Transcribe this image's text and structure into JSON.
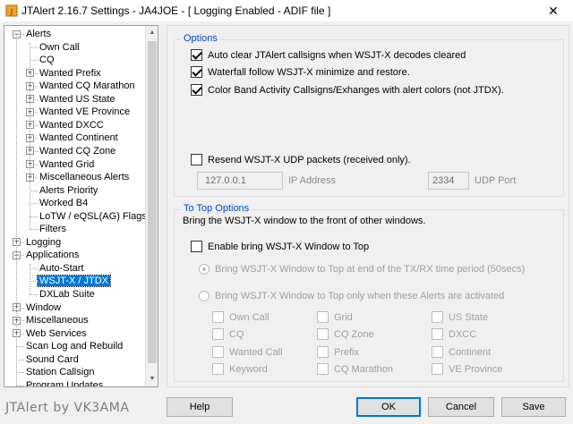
{
  "window": {
    "title": "JTAlert 2.16.7 Settings  -  JA4JOE  -  [ Logging Enabled - ADIF file ]",
    "close_glyph": "✕"
  },
  "tree": {
    "items": [
      {
        "label": "Alerts",
        "level": 0,
        "expander": "−"
      },
      {
        "label": "Own Call",
        "level": 1
      },
      {
        "label": "CQ",
        "level": 1
      },
      {
        "label": "Wanted Prefix",
        "level": 1,
        "expander": "+"
      },
      {
        "label": "Wanted CQ Marathon",
        "level": 1,
        "expander": "+"
      },
      {
        "label": "Wanted US State",
        "level": 1,
        "expander": "+"
      },
      {
        "label": "Wanted VE Province",
        "level": 1,
        "expander": "+"
      },
      {
        "label": "Wanted DXCC",
        "level": 1,
        "expander": "+"
      },
      {
        "label": "Wanted Continent",
        "level": 1,
        "expander": "+"
      },
      {
        "label": "Wanted CQ Zone",
        "level": 1,
        "expander": "+"
      },
      {
        "label": "Wanted Grid",
        "level": 1,
        "expander": "+"
      },
      {
        "label": "Miscellaneous Alerts",
        "level": 1,
        "expander": "+"
      },
      {
        "label": "Alerts Priority",
        "level": 1
      },
      {
        "label": "Worked B4",
        "level": 1
      },
      {
        "label": "LoTW / eQSL(AG) Flags",
        "level": 1
      },
      {
        "label": "Filters",
        "level": 1
      },
      {
        "label": "Logging",
        "level": 0,
        "expander": "+"
      },
      {
        "label": "Applications",
        "level": 0,
        "expander": "−"
      },
      {
        "label": "Auto-Start",
        "level": 1
      },
      {
        "label": "WSJT-X / JTDX",
        "level": 1,
        "selected": true
      },
      {
        "label": "DXLab Suite",
        "level": 1
      },
      {
        "label": "Window",
        "level": 0,
        "expander": "+"
      },
      {
        "label": "Miscellaneous",
        "level": 0,
        "expander": "+"
      },
      {
        "label": "Web Services",
        "level": 0,
        "expander": "+"
      },
      {
        "label": "Scan Log and Rebuild",
        "level": 0
      },
      {
        "label": "Sound Card",
        "level": 0
      },
      {
        "label": "Station Callsign",
        "level": 0
      },
      {
        "label": "Program Updates",
        "level": 0
      }
    ]
  },
  "options": {
    "title": "Options",
    "auto_clear": "Auto clear JTAlert callsigns when WSJT-X decodes cleared",
    "waterfall_follow": "Waterfall follow WSJT-X minimize and restore.",
    "color_band": "Color Band Activity Callsigns/Exhanges with alert colors (not JTDX).",
    "resend_udp": "Resend WSJT-X UDP packets (received only).",
    "ip_value": "127.0.0.1",
    "ip_label": "IP Address",
    "port_value": "2334",
    "port_label": "UDP Port"
  },
  "to_top": {
    "title": "To Top Options",
    "description": "Bring the WSJT-X window to the front of other windows.",
    "enable": "Enable bring WSJT-X Window to Top",
    "radio_end": "Bring WSJT-X Window to Top at end of the TX/RX time period (50secs)",
    "radio_alerts": "Bring WSJT-X Window to Top only when these Alerts are activated",
    "alerts": {
      "own_call": "Own Call",
      "cq": "CQ",
      "wanted_call": "Wanted Call",
      "keyword": "Keyword",
      "grid": "Grid",
      "cq_zone": "CQ Zone",
      "prefix": "Prefix",
      "cq_marathon": "CQ Marathon",
      "us_state": "US State",
      "dxcc": "DXCC",
      "continent": "Continent",
      "ve_province": "VE Province"
    }
  },
  "footer": {
    "brand": "JTAlert by VK3AMA",
    "help": "Help",
    "ok": "OK",
    "cancel": "Cancel",
    "save": "Save"
  },
  "colors": {
    "group_title": "#0046d5",
    "selection": "#0078d7"
  }
}
